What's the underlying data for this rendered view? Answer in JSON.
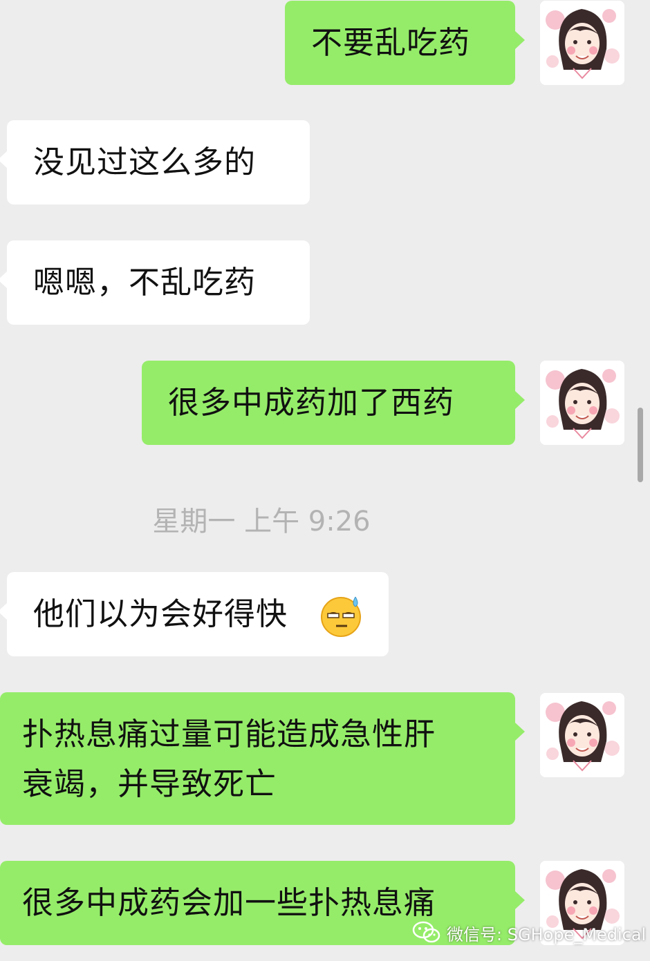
{
  "messages": [
    {
      "side": "out",
      "text": "不要乱吃药"
    },
    {
      "side": "in",
      "text": "没见过这么多的"
    },
    {
      "side": "in",
      "text": "嗯嗯，不乱吃药"
    },
    {
      "side": "out",
      "text": "很多中成药加了西药"
    },
    {
      "side": "in",
      "text": "他们以为会好得快"
    },
    {
      "side": "out",
      "text": "扑热息痛过量可能造成急性肝\n衰竭，并导致死亡"
    },
    {
      "side": "out",
      "text": "很多中成药会加一些扑热息痛"
    }
  ],
  "timestamp": "星期一 上午 9:26",
  "emoji": "sweat-smile-emoji",
  "watermark": {
    "icon": "wechat-icon",
    "text": "微信号: SGHope_Medical"
  },
  "colors": {
    "background": "#ededed",
    "outgoing_bubble": "#95ec69",
    "incoming_bubble": "#ffffff"
  }
}
